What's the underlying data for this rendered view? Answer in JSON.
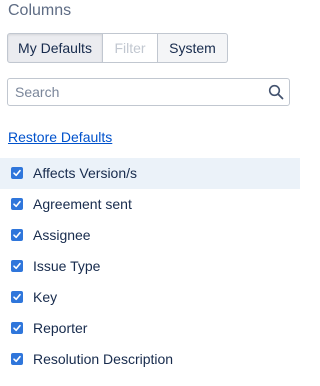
{
  "panel": {
    "title": "Columns"
  },
  "tabs": [
    {
      "label": "My Defaults",
      "state": "selected"
    },
    {
      "label": "Filter",
      "state": "disabled"
    },
    {
      "label": "System",
      "state": "normal"
    }
  ],
  "search": {
    "placeholder": "Search",
    "value": "",
    "icon": "search-icon"
  },
  "restore_link": "Restore Defaults",
  "colors": {
    "link": "#0052cc",
    "checkbox": "#2f76db",
    "highlight_row": "#ebf2f9"
  },
  "columns": [
    {
      "label": "Affects Version/s",
      "checked": true,
      "highlighted": true
    },
    {
      "label": "Agreement sent",
      "checked": true,
      "highlighted": false
    },
    {
      "label": "Assignee",
      "checked": true,
      "highlighted": false
    },
    {
      "label": "Issue Type",
      "checked": true,
      "highlighted": false
    },
    {
      "label": "Key",
      "checked": true,
      "highlighted": false
    },
    {
      "label": "Reporter",
      "checked": true,
      "highlighted": false
    },
    {
      "label": "Resolution Description",
      "checked": true,
      "highlighted": false
    }
  ]
}
